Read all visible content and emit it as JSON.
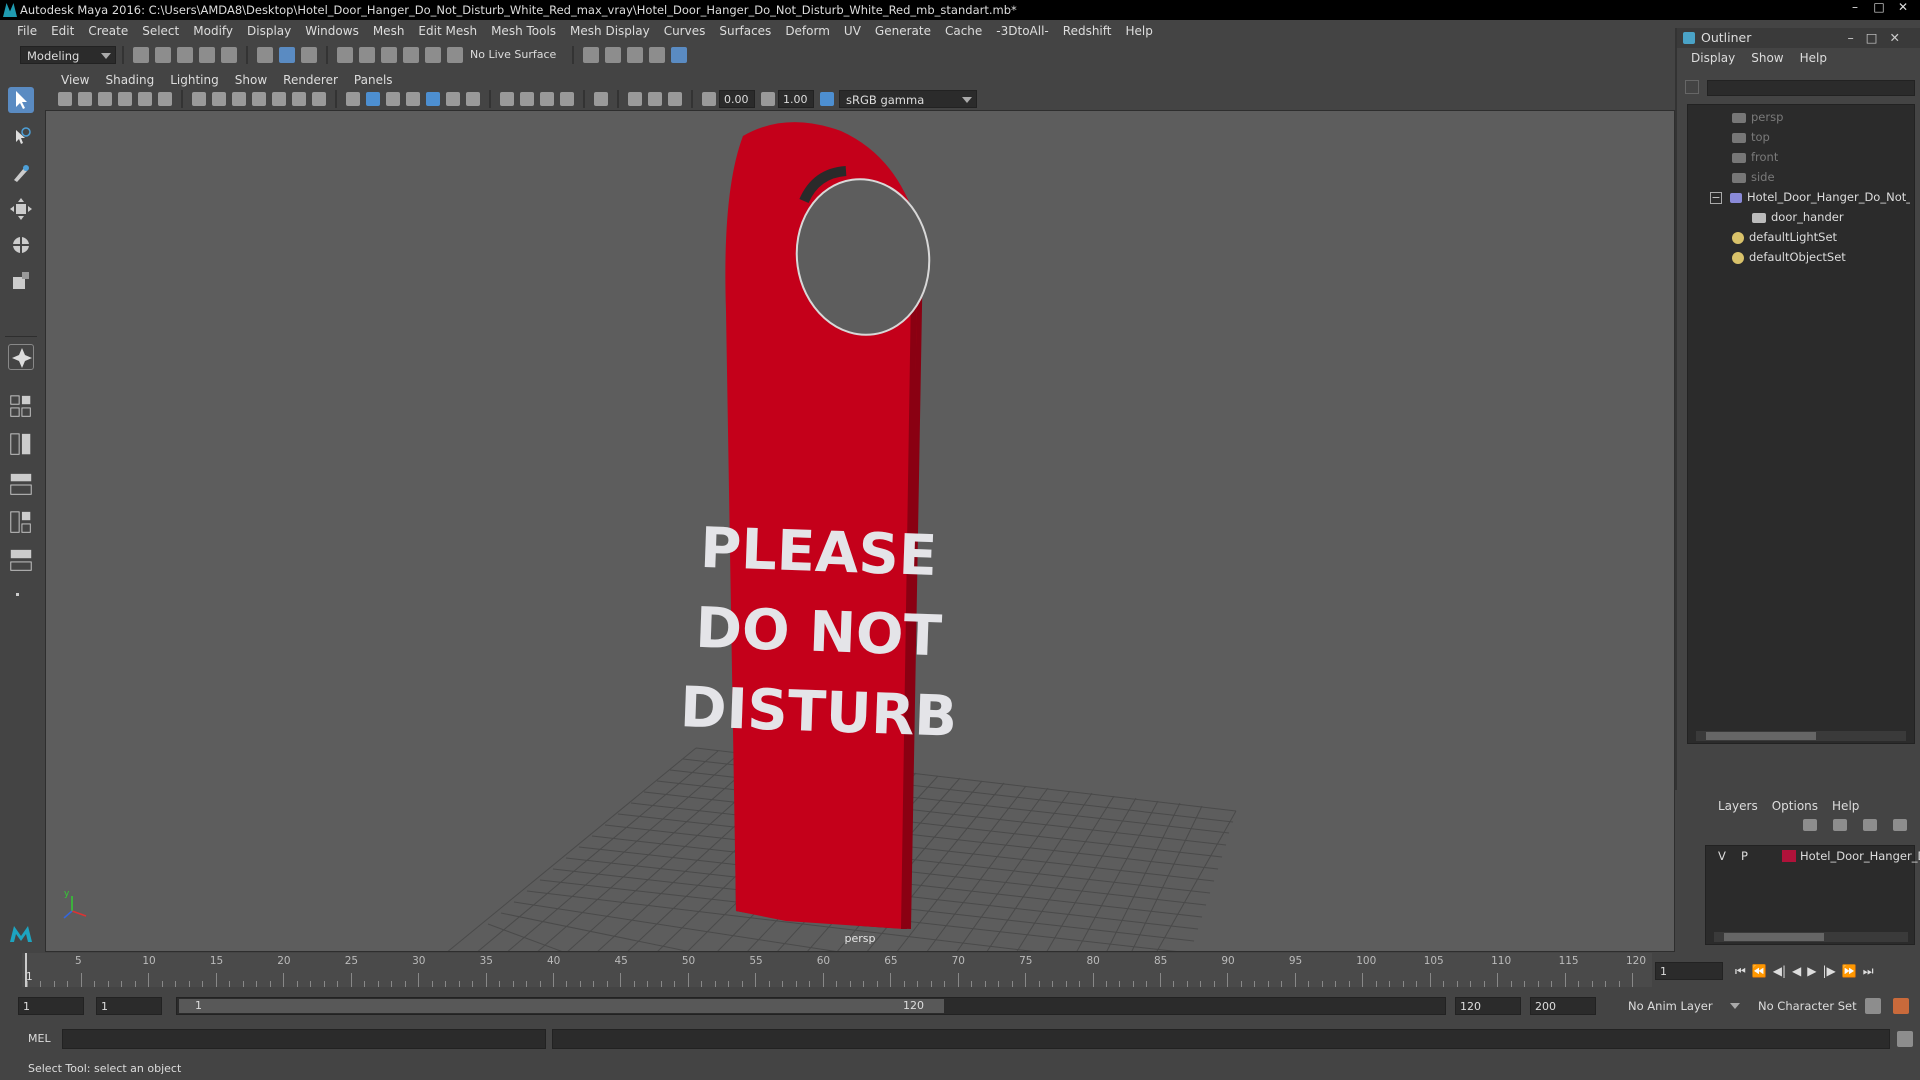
{
  "window": {
    "title": "Autodesk Maya 2016: C:\\Users\\AMDA8\\Desktop\\Hotel_Door_Hanger_Do_Not_Disturb_White_Red_max_vray\\Hotel_Door_Hanger_Do_Not_Disturb_White_Red_mb_standart.mb*"
  },
  "menubar": [
    "File",
    "Edit",
    "Create",
    "Select",
    "Modify",
    "Display",
    "Windows",
    "Mesh",
    "Edit Mesh",
    "Mesh Tools",
    "Mesh Display",
    "Curves",
    "Surfaces",
    "Deform",
    "UV",
    "Generate",
    "Cache",
    "-3DtoAll-",
    "Redshift",
    "Help"
  ],
  "statusline": {
    "mode": "Modeling",
    "live_surface": "No Live Surface"
  },
  "viewport_menu": [
    "View",
    "Shading",
    "Lighting",
    "Show",
    "Renderer",
    "Panels"
  ],
  "viewport_toolbar": {
    "exposure": "0.00",
    "gamma": "1.00",
    "colorspace": "sRGB gamma"
  },
  "viewport": {
    "camera": "persp",
    "sign_text": [
      "PLEASE",
      "DO NOT",
      "DISTURB"
    ],
    "sign_color": "#c4001a"
  },
  "outliner": {
    "title": "Outliner",
    "menu": [
      "Display",
      "Show",
      "Help"
    ],
    "items": [
      {
        "label": "persp",
        "icon": "camera-icon",
        "dim": true
      },
      {
        "label": "top",
        "icon": "camera-icon",
        "dim": true
      },
      {
        "label": "front",
        "icon": "camera-icon",
        "dim": true
      },
      {
        "label": "side",
        "icon": "camera-icon",
        "dim": true
      },
      {
        "label": "Hotel_Door_Hanger_Do_Not_D",
        "icon": "group-icon",
        "dim": false
      },
      {
        "label": "door_hander",
        "icon": "mesh-icon",
        "dim": false
      },
      {
        "label": "defaultLightSet",
        "icon": "set-icon",
        "dim": false
      },
      {
        "label": "defaultObjectSet",
        "icon": "set-icon",
        "dim": false
      }
    ]
  },
  "layers": {
    "menu": [
      "Layers",
      "Options",
      "Help"
    ],
    "row": {
      "v": "V",
      "p": "P",
      "name": "Hotel_Door_Hanger_D",
      "color": "#b0123a"
    }
  },
  "timeline": {
    "ticks": [
      "5",
      "10",
      "15",
      "20",
      "25",
      "30",
      "35",
      "40",
      "45",
      "50",
      "55",
      "60",
      "65",
      "70",
      "75",
      "80",
      "85",
      "90",
      "95",
      "100",
      "105",
      "110",
      "115",
      "120"
    ],
    "start_marker": "1",
    "current_frame": "1"
  },
  "range": {
    "start": "1",
    "anim_start": "1",
    "slider_start": "1",
    "slider_end": "120",
    "anim_end": "120",
    "end": "200",
    "anim_layer": "No Anim Layer",
    "character_set": "No Character Set"
  },
  "cmdline": {
    "label": "MEL",
    "help": "Select Tool: select an object"
  }
}
